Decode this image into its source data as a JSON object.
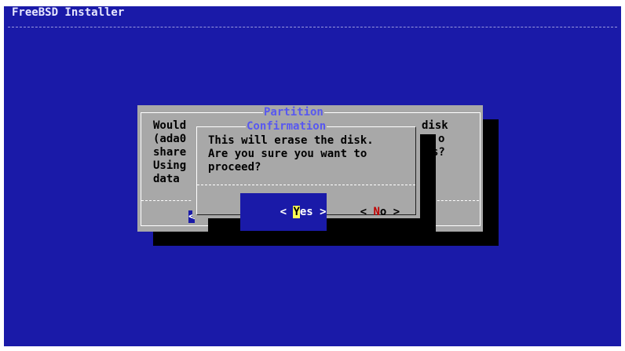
{
  "app": {
    "title": "FreeBSD Installer"
  },
  "partition_dialog": {
    "title": "Partition",
    "lines": [
      "Would",
      "(ada0",
      "share",
      "Using",
      "data"
    ],
    "right_fragments": [
      "disk",
      "o",
      "s?"
    ],
    "left_button_fragment": "<"
  },
  "confirm_dialog": {
    "title": "Confirmation",
    "message_lines": [
      "This will erase the disk.",
      "Are you sure you want to",
      "proceed?"
    ],
    "buttons": {
      "yes": {
        "left": "< ",
        "hotkey": "Y",
        "rest": "es",
        "right": " >",
        "selected": true
      },
      "no": {
        "left": "< ",
        "hotkey": "N",
        "rest": "o",
        "right": " >",
        "selected": false
      }
    }
  },
  "colors": {
    "background": "#1a1aa8",
    "dialog": "#a8a8a8",
    "title_text": "#5858f0",
    "hotkey_no": "#c00000",
    "hotkey_yes": "#ffff55"
  }
}
